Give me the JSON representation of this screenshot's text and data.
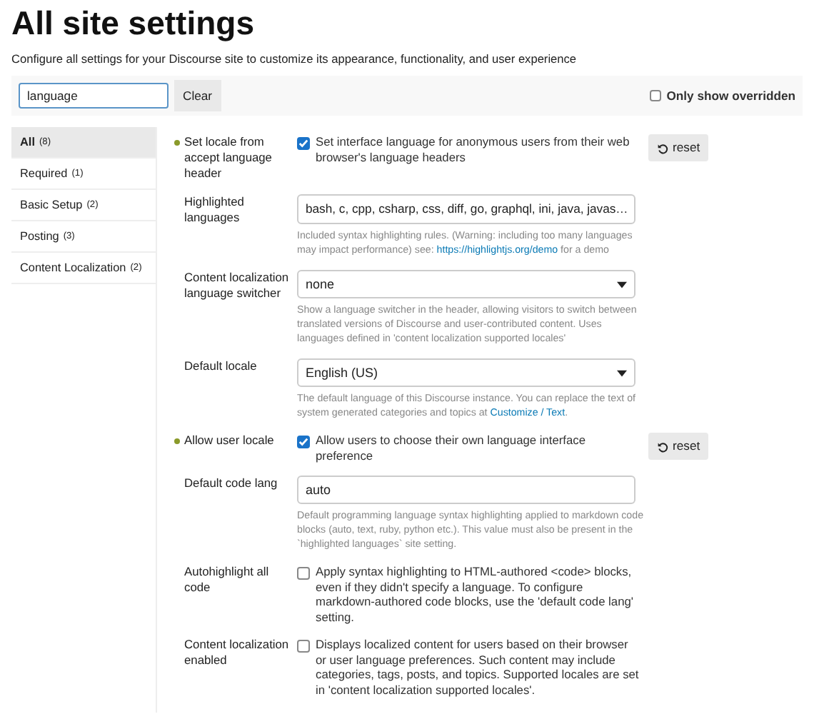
{
  "title": "All site settings",
  "subtitle": "Configure all settings for your Discourse site to customize its appearance, functionality, and user experience",
  "filter": {
    "value": "language",
    "clear_label": "Clear",
    "only_overridden": {
      "label": "Only show overridden",
      "checked": false
    }
  },
  "categories": [
    {
      "label": "All",
      "count": "(8)",
      "selected": true
    },
    {
      "label": "Required",
      "count": "(1)",
      "selected": false
    },
    {
      "label": "Basic Setup",
      "count": "(2)",
      "selected": false
    },
    {
      "label": "Posting",
      "count": "(3)",
      "selected": false
    },
    {
      "label": "Content Localization",
      "count": "(2)",
      "selected": false
    }
  ],
  "settings": [
    {
      "kind": "checkbox",
      "label": "Set locale from accept language header",
      "overridden": true,
      "checked": true,
      "text": "Set interface language for anonymous users from their web browser's language headers",
      "reset_label": "reset"
    },
    {
      "kind": "list",
      "label": "Highlighted languages",
      "overridden": false,
      "value": "bash, c, cpp, csharp, css, diff, go, graphql, ini, java, javas…",
      "description": [
        {
          "kind": "text",
          "text": "Included syntax highlighting rules. (Warning: including too many languages may impact performance) see: "
        },
        {
          "kind": "link",
          "text": "https://highlightjs.org/demo"
        },
        {
          "kind": "text",
          "text": " for a demo"
        }
      ]
    },
    {
      "kind": "select",
      "label": "Content localization language switcher",
      "overridden": false,
      "value": "none",
      "description": [
        {
          "kind": "text",
          "text": "Show a language switcher in the header, allowing visitors to switch between translated versions of Discourse and user-contributed content. Uses languages defined in 'content localization supported locales'"
        }
      ]
    },
    {
      "kind": "select",
      "label": "Default locale",
      "overridden": false,
      "value": "English (US)",
      "description": [
        {
          "kind": "text",
          "text": "The default language of this Discourse instance. You can replace the text of system generated categories and topics at "
        },
        {
          "kind": "link",
          "text": "Customize / Text"
        },
        {
          "kind": "text",
          "text": "."
        }
      ]
    },
    {
      "kind": "checkbox",
      "label": "Allow user locale",
      "overridden": true,
      "checked": true,
      "text": "Allow users to choose their own language interface preference",
      "reset_label": "reset"
    },
    {
      "kind": "text",
      "label": "Default code lang",
      "overridden": false,
      "value": "auto",
      "description": [
        {
          "kind": "text",
          "text": "Default programming language syntax highlighting applied to markdown code blocks (auto, text, ruby, python etc.). This value must also be present in the `highlighted languages` site setting."
        }
      ]
    },
    {
      "kind": "checkbox",
      "label": "Autohighlight all code",
      "overridden": false,
      "checked": false,
      "text": "Apply syntax highlighting to HTML-authored <code> blocks, even if they didn't specify a language. To configure markdown-authored code blocks, use the 'default code lang' setting."
    },
    {
      "kind": "checkbox",
      "label": "Content localization enabled",
      "overridden": false,
      "checked": false,
      "text": "Displays localized content for users based on their browser or user language preferences. Such content may include categories, tags, posts, and topics. Supported locales are set in 'content localization supported locales'."
    }
  ]
}
